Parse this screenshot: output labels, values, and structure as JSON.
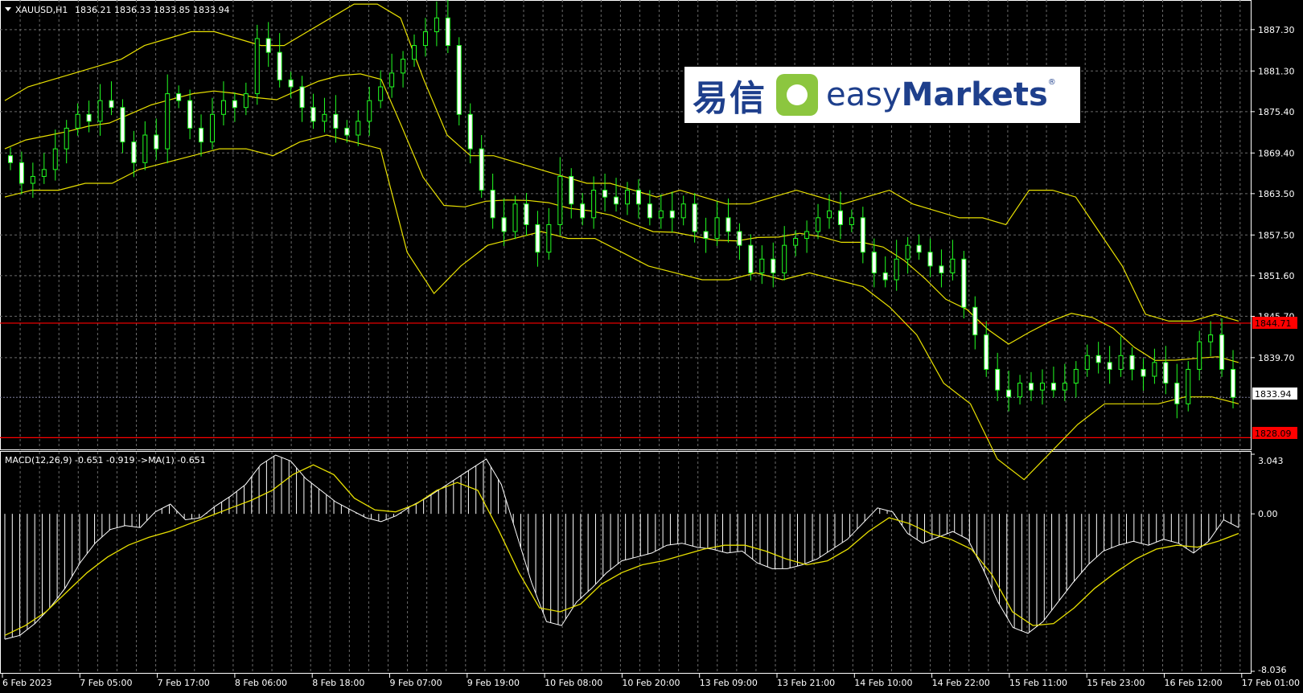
{
  "header": {
    "symbol": "XAUUSD,H1",
    "ohlc": "1836.21 1836.33 1833.85 1833.94"
  },
  "macd_header": "MACD(12,26,9) -0.651 -0.919  ->MA(1) -0.651",
  "logo": {
    "cn": "易信",
    "en_plain": "easy",
    "en_bold": "Markets",
    "reg": "®"
  },
  "price_badges": {
    "resistance": "1844.71",
    "current": "1833.94",
    "support": "1828.09"
  },
  "colors": {
    "bull_candle": "#22ff22",
    "bollinger": "#e8e000",
    "macd_hist": "#ffffff",
    "signal": "#e8e000",
    "level_line": "#ff0000",
    "grid": "#6a6a6a"
  },
  "chart_data": [
    {
      "type": "line",
      "title": "XAUUSD,H1",
      "ylabels": [
        "1887.30",
        "1881.30",
        "1875.40",
        "1869.40",
        "1863.50",
        "1857.50",
        "1851.60",
        "1845.70",
        "1839.70",
        "1833.94"
      ],
      "xlabels": [
        "6 Feb 2023",
        "7 Feb 05:00",
        "7 Feb 17:00",
        "8 Feb 06:00",
        "8 Feb 18:00",
        "9 Feb 07:00",
        "9 Feb 19:00",
        "10 Feb 08:00",
        "10 Feb 20:00",
        "13 Feb 09:00",
        "13 Feb 21:00",
        "14 Feb 10:00",
        "14 Feb 22:00",
        "15 Feb 11:00",
        "15 Feb 23:00",
        "16 Feb 12:00",
        "17 Feb 01:00"
      ],
      "ylim": [
        1826.5,
        1891.6
      ],
      "hlines": [
        1844.71,
        1828.09,
        1833.94
      ],
      "series": [
        {
          "name": "Close",
          "values": [
            1868,
            1865,
            1866,
            1867,
            1870,
            1873,
            1875,
            1874,
            1877,
            1876,
            1871,
            1868,
            1872,
            1870,
            1878,
            1877,
            1873,
            1871,
            1875,
            1877,
            1876,
            1878,
            1886,
            1884,
            1880,
            1879,
            1876,
            1874,
            1875,
            1873,
            1872,
            1874,
            1877,
            1879,
            1881,
            1883,
            1885,
            1887,
            1889,
            1885,
            1875,
            1870,
            1864,
            1860,
            1858,
            1862,
            1859,
            1855,
            1859,
            1866,
            1862,
            1860,
            1864,
            1863,
            1862,
            1864,
            1862,
            1860,
            1861,
            1860,
            1862,
            1858,
            1857,
            1860,
            1858,
            1856,
            1852,
            1854,
            1852,
            1856,
            1857,
            1858,
            1860,
            1861,
            1859,
            1860,
            1855,
            1852,
            1851,
            1854,
            1856,
            1855,
            1853,
            1852,
            1854,
            1847,
            1843,
            1838,
            1835,
            1834,
            1836,
            1835,
            1836,
            1835,
            1836,
            1838,
            1840,
            1839,
            1838,
            1840,
            1838,
            1837,
            1839,
            1836,
            1833,
            1838,
            1842,
            1843,
            1838,
            1833.94
          ]
        },
        {
          "name": "BB Upper",
          "values": [
            1877,
            1879,
            1880,
            1881,
            1882,
            1883,
            1885,
            1886,
            1887,
            1887,
            1886,
            1885,
            1885,
            1887,
            1889,
            1891,
            1891,
            1889,
            1880,
            1872,
            1869,
            1869,
            1868,
            1867,
            1866,
            1865,
            1865,
            1864,
            1863,
            1864,
            1863,
            1862,
            1862,
            1863,
            1864,
            1863,
            1862,
            1863,
            1864,
            1862,
            1861,
            1860,
            1860,
            1859,
            1864,
            1864,
            1863,
            1858,
            1853,
            1846,
            1845,
            1845,
            1846,
            1845
          ]
        },
        {
          "name": "BB Lower",
          "values": [
            1863,
            1864,
            1864,
            1865,
            1865,
            1867,
            1868,
            1869,
            1870,
            1870,
            1869,
            1871,
            1872,
            1871,
            1870,
            1855,
            1849,
            1853,
            1856,
            1857,
            1858,
            1857,
            1857,
            1855,
            1853,
            1852,
            1851,
            1851,
            1852,
            1851,
            1852,
            1851,
            1850,
            1847,
            1843,
            1836,
            1833,
            1825,
            1822,
            1826,
            1830,
            1833,
            1833,
            1833,
            1834,
            1834,
            1833
          ]
        }
      ]
    },
    {
      "type": "bar",
      "title": "MACD(12,26,9)",
      "ylabels": [
        "3.043",
        "0.00",
        "-8.036"
      ],
      "ylim": [
        -8.036,
        3.043
      ],
      "series": [
        {
          "name": "MACD",
          "values": [
            -6.4,
            -6.2,
            -5.6,
            -4.8,
            -3.8,
            -2.5,
            -1.5,
            -0.8,
            -0.6,
            -0.7,
            0.1,
            0.5,
            -0.3,
            -0.2,
            0.4,
            0.9,
            1.5,
            2.5,
            3.0,
            2.7,
            1.8,
            1.2,
            0.6,
            0.2,
            -0.2,
            -0.4,
            -0.1,
            0.4,
            0.8,
            1.3,
            1.8,
            2.3,
            2.8,
            1.5,
            -1.0,
            -3.5,
            -5.5,
            -5.7,
            -4.5,
            -3.8,
            -3.0,
            -2.4,
            -2.2,
            -2.0,
            -1.6,
            -1.5,
            -1.7,
            -1.8,
            -2.0,
            -1.9,
            -2.5,
            -2.8,
            -2.8,
            -2.6,
            -2.3,
            -1.8,
            -1.3,
            -0.5,
            0.3,
            0.1,
            -1.0,
            -1.5,
            -1.2,
            -0.9,
            -1.3,
            -2.8,
            -4.5,
            -5.8,
            -6.1,
            -5.5,
            -4.5,
            -3.5,
            -2.6,
            -1.9,
            -1.6,
            -1.4,
            -1.6,
            -1.3,
            -1.5,
            -2.0,
            -1.4,
            -0.3,
            -0.7
          ]
        },
        {
          "name": "Signal",
          "values": [
            -6.2,
            -5.7,
            -5.0,
            -4.0,
            -3.0,
            -2.2,
            -1.6,
            -1.2,
            -0.9,
            -0.5,
            -0.1,
            0.3,
            0.7,
            1.2,
            2.0,
            2.5,
            2.0,
            0.8,
            0.2,
            0.1,
            0.5,
            1.2,
            1.6,
            1.2,
            -0.8,
            -3.0,
            -4.8,
            -5.0,
            -4.6,
            -3.6,
            -3.0,
            -2.6,
            -2.4,
            -2.1,
            -1.8,
            -1.6,
            -1.6,
            -1.9,
            -2.3,
            -2.6,
            -2.4,
            -1.8,
            -0.9,
            -0.2,
            -0.5,
            -1.0,
            -1.3,
            -1.8,
            -3.1,
            -5.0,
            -5.7,
            -5.6,
            -4.8,
            -3.8,
            -3.0,
            -2.3,
            -1.8,
            -1.6,
            -1.7,
            -1.4,
            -1.0
          ]
        }
      ]
    }
  ]
}
